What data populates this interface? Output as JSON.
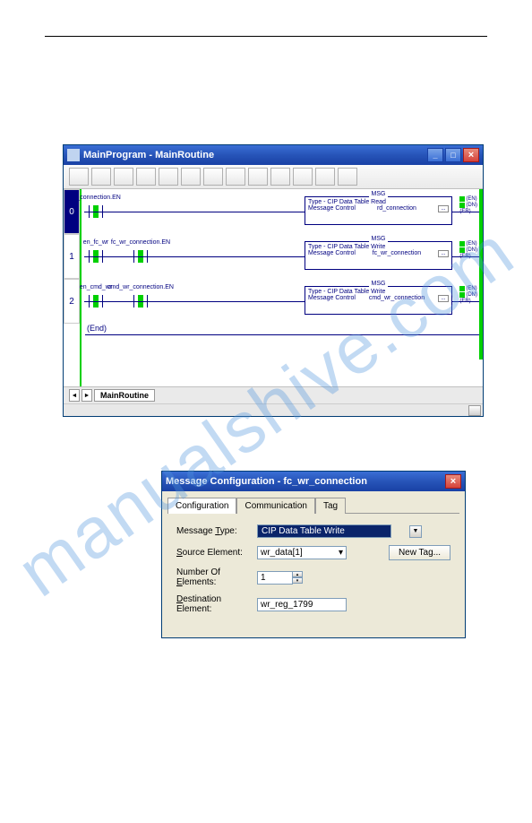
{
  "watermark": "manualshive.com",
  "window1": {
    "title": "MainProgram - MainRoutine",
    "rungs": [
      {
        "num": "0",
        "contacts": [
          {
            "label": "rd_connection.EN",
            "x": 8
          }
        ],
        "msg": {
          "title": "MSG",
          "type": "Type - CIP Data Table Read",
          "ctrl": "Message Control",
          "tag": "rd_connection"
        }
      },
      {
        "num": "1",
        "contacts": [
          {
            "label": "en_fc_wr",
            "x": 8
          },
          {
            "label": "fc_wr_connection.EN",
            "x": 58
          }
        ],
        "msg": {
          "title": "MSG",
          "type": "Type - CIP Data Table Write",
          "ctrl": "Message Control",
          "tag": "fc_wr_connection"
        }
      },
      {
        "num": "2",
        "contacts": [
          {
            "label": "en_cmd_wr",
            "x": 8
          },
          {
            "label": "cmd_wr_connection.EN",
            "x": 58
          }
        ],
        "msg": {
          "title": "MSG",
          "type": "Type - CIP Data Table Write",
          "ctrl": "Message Control",
          "tag": "cmd_wr_connection"
        }
      }
    ],
    "flags": [
      "(EN)",
      "(DN)",
      "(ER)"
    ],
    "end": "(End)",
    "tab": "MainRoutine"
  },
  "dialog": {
    "title": "Message Configuration - fc_wr_connection",
    "tabs": [
      "Configuration",
      "Communication",
      "Tag"
    ],
    "msgTypeLabel": "Message Type:",
    "msgTypeValue": "CIP Data Table Write",
    "srcLabel": "Source Element:",
    "srcValue": "wr_data[1]",
    "numLabel": "Number Of Elements:",
    "numValue": "1",
    "destLabel": "Destination Element:",
    "destValue": "wr_reg_1799",
    "newTag": "New Tag..."
  }
}
